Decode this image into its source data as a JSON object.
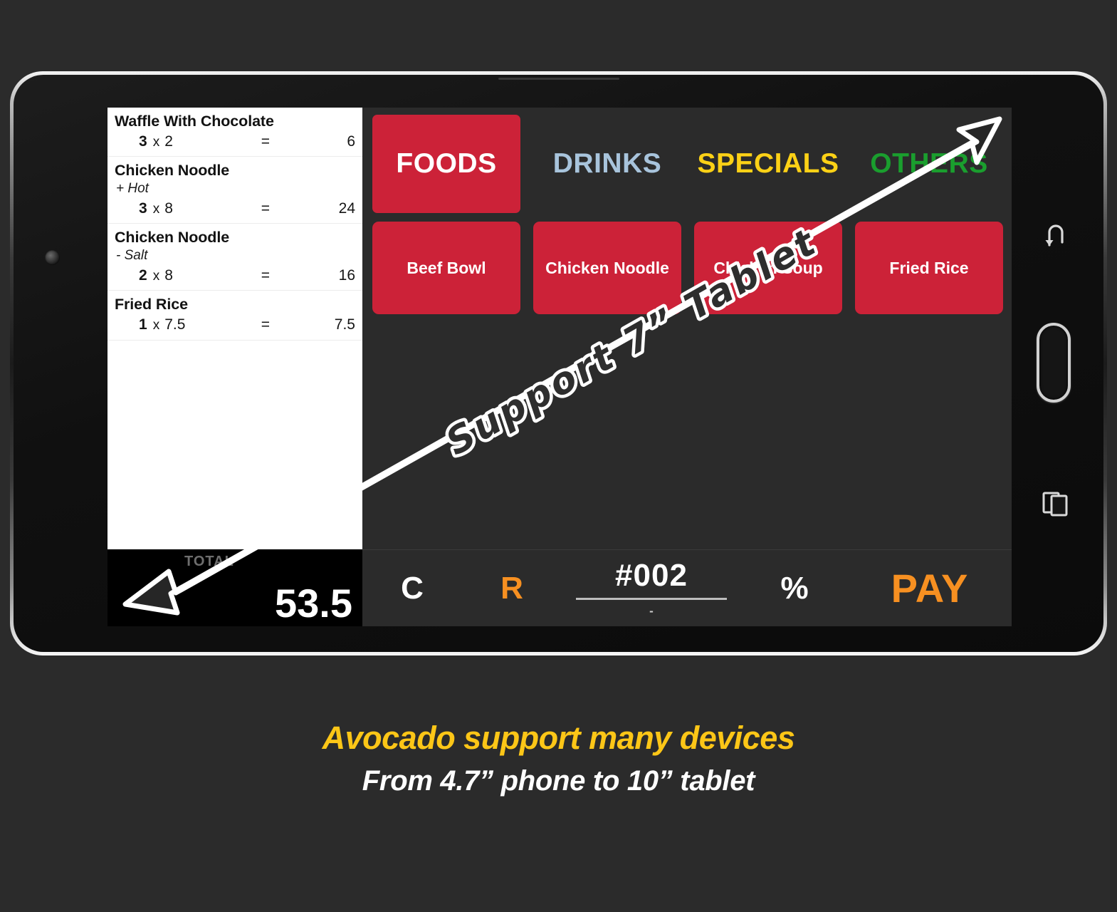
{
  "device": {
    "type": "android-tablet",
    "nav": {
      "back_icon": "back-arrow-icon",
      "home_icon": "home-pill-icon",
      "recents_icon": "recents-squares-icon"
    },
    "camera_icon": "front-camera-icon",
    "speaker_icon": "earpiece-speaker-icon"
  },
  "app": {
    "name": "Avocado",
    "colors": {
      "accent_red": "#cc2238",
      "accent_orange": "#f79021",
      "tab_drinks": "#a8c4dc",
      "tab_specials": "#fcd116",
      "tab_others": "#1a9e2e",
      "caption_yellow": "#fcc617",
      "panel_dark": "#2b2b2b",
      "total_bar": "#000000"
    }
  },
  "order": {
    "items": [
      {
        "name": "Waffle With Chocolate",
        "modifier": "",
        "qty": "3",
        "mul": "x",
        "price": "2",
        "eq": "=",
        "total": "6"
      },
      {
        "name": "Chicken Noodle",
        "modifier": "+ Hot",
        "qty": "3",
        "mul": "x",
        "price": "8",
        "eq": "=",
        "total": "24"
      },
      {
        "name": "Chicken Noodle",
        "modifier": "- Salt",
        "qty": "2",
        "mul": "x",
        "price": "8",
        "eq": "=",
        "total": "16"
      },
      {
        "name": "Fried Rice",
        "modifier": "",
        "qty": "1",
        "mul": "x",
        "price": "7.5",
        "eq": "=",
        "total": "7.5"
      }
    ],
    "total_label": "TOTAL",
    "total_value": "53.5"
  },
  "catalog": {
    "tabs": [
      {
        "label": "FOODS",
        "color": "#ffffff",
        "active": true
      },
      {
        "label": "DRINKS",
        "color": "#a8c4dc",
        "active": false
      },
      {
        "label": "SPECIALS",
        "color": "#fcd116",
        "active": false
      },
      {
        "label": "OTHERS",
        "color": "#1a9e2e",
        "active": false
      }
    ],
    "products": [
      {
        "label": "Beef Bowl"
      },
      {
        "label": "Chicken Noodle"
      },
      {
        "label": "Chicken Soup"
      },
      {
        "label": "Fried Rice"
      }
    ]
  },
  "action_bar": {
    "clear_label": "C",
    "recall_label": "R",
    "ticket_value": "#002",
    "ticket_hint": "-",
    "percent_label": "%",
    "pay_label": "PAY"
  },
  "annotation": {
    "arrow_label": "Support 7” Tablet",
    "arrow_icon": "double-headed-diagonal-arrow-icon"
  },
  "caption": {
    "line1": "Avocado support many devices",
    "line2": "From 4.7” phone to 10” tablet"
  }
}
